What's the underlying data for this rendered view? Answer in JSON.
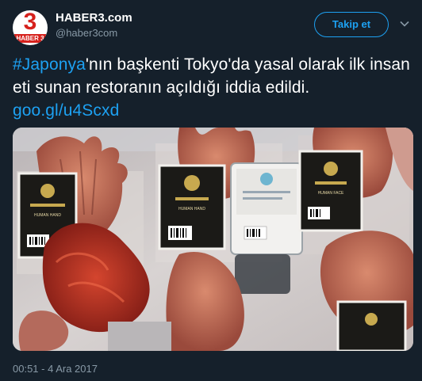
{
  "account": {
    "name": "HABER3.com",
    "handle": "@haber3com",
    "avatar_number": "3",
    "avatar_label": "HABER 3"
  },
  "follow_label": "Takip et",
  "tweet": {
    "hashtag": "#Japonya",
    "text": "'nın başkenti Tokyo'da yasal olarak ilk insan eti sunan restoranın açıldığı iddia edildi.",
    "link": "goo.gl/u4Scxd"
  },
  "photo": {
    "package_labels": [
      "HUMAN HAND",
      "HUMAN HAND",
      "HUMAN FACE"
    ]
  },
  "timestamp": "00:51 - 4 Ara 2017",
  "colors": {
    "background": "#15202b",
    "accent": "#1da1f2",
    "muted": "#8899a6",
    "brand_red": "#d6211c"
  },
  "icons": {
    "more": "chevron-down-icon"
  }
}
